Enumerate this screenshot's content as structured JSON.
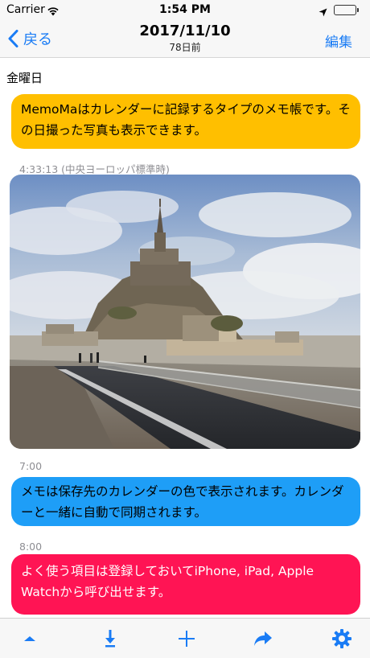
{
  "status": {
    "carrier": "Carrier",
    "time": "1:54 PM",
    "battery_level": 1.0
  },
  "nav": {
    "back_label": "戻る",
    "title": "2017/11/10",
    "subtitle": "78日前",
    "edit_label": "編集"
  },
  "content": {
    "day_label": "金曜日",
    "memos": [
      {
        "text": "MemoMaはカレンダーに記録するタイプのメモ帳です。その日撮った写真も表示できます。",
        "color": "#ffbf00"
      },
      {
        "time": "4:33:13 (中央ヨーロッパ標準時)",
        "kind": "photo"
      },
      {
        "time": "7:00",
        "text": "メモは保存先のカレンダーの色で表示されます。カレンダーと一緒に自動で同期されます。",
        "color": "#1e9ef7"
      },
      {
        "time": "8:00",
        "text": "よく使う項目は登録しておいてiPhone, iPad, Apple Watchから呼び出せます。",
        "color": "#ff1454"
      }
    ]
  },
  "toolbar": {
    "icons": [
      "caret-up-icon",
      "download-icon",
      "plus-icon",
      "share-icon",
      "gear-icon"
    ],
    "tint": "#1a7cf5"
  }
}
